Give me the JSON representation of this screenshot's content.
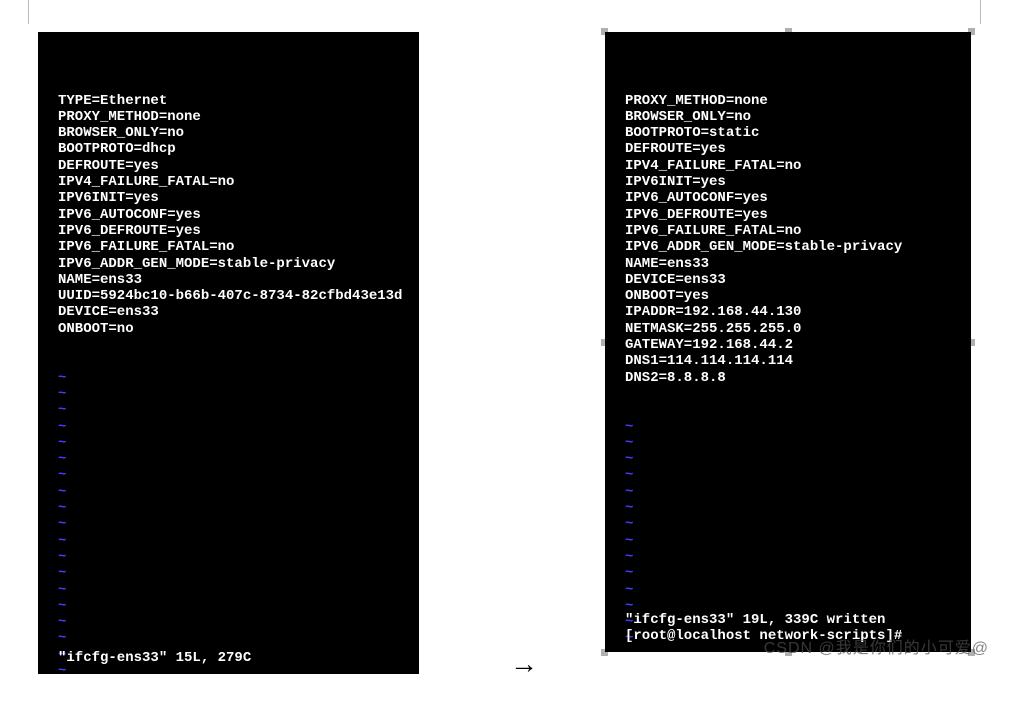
{
  "left_terminal": {
    "lines": [
      "TYPE=Ethernet",
      "PROXY_METHOD=none",
      "BROWSER_ONLY=no",
      "BOOTPROTO=dhcp",
      "DEFROUTE=yes",
      "IPV4_FAILURE_FATAL=no",
      "IPV6INIT=yes",
      "IPV6_AUTOCONF=yes",
      "IPV6_DEFROUTE=yes",
      "IPV6_FAILURE_FATAL=no",
      "IPV6_ADDR_GEN_MODE=stable-privacy",
      "NAME=ens33",
      "UUID=5924bc10-b66b-407c-8734-82cfbd43e13d",
      "DEVICE=ens33",
      "ONBOOT=no"
    ],
    "tilde_count": 19,
    "status": "\"ifcfg-ens33\" 15L, 279C"
  },
  "right_terminal": {
    "lines": [
      "PROXY_METHOD=none",
      "BROWSER_ONLY=no",
      "BOOTPROTO=static",
      "DEFROUTE=yes",
      "IPV4_FAILURE_FATAL=no",
      "IPV6INIT=yes",
      "IPV6_AUTOCONF=yes",
      "IPV6_DEFROUTE=yes",
      "IPV6_FAILURE_FATAL=no",
      "IPV6_ADDR_GEN_MODE=stable-privacy",
      "NAME=ens33",
      "DEVICE=ens33",
      "ONBOOT=yes",
      "IPADDR=192.168.44.130",
      "NETMASK=255.255.255.0",
      "GATEWAY=192.168.44.2",
      "DNS1=114.114.114.114",
      "DNS2=8.8.8.8"
    ],
    "tilde_count": 14,
    "status1": "\"ifcfg-ens33\" 19L, 339C written",
    "status2": "[root@localhost network-scripts]#"
  },
  "arrow": "→",
  "watermark": "CSDN @我是你们的小可爱@"
}
